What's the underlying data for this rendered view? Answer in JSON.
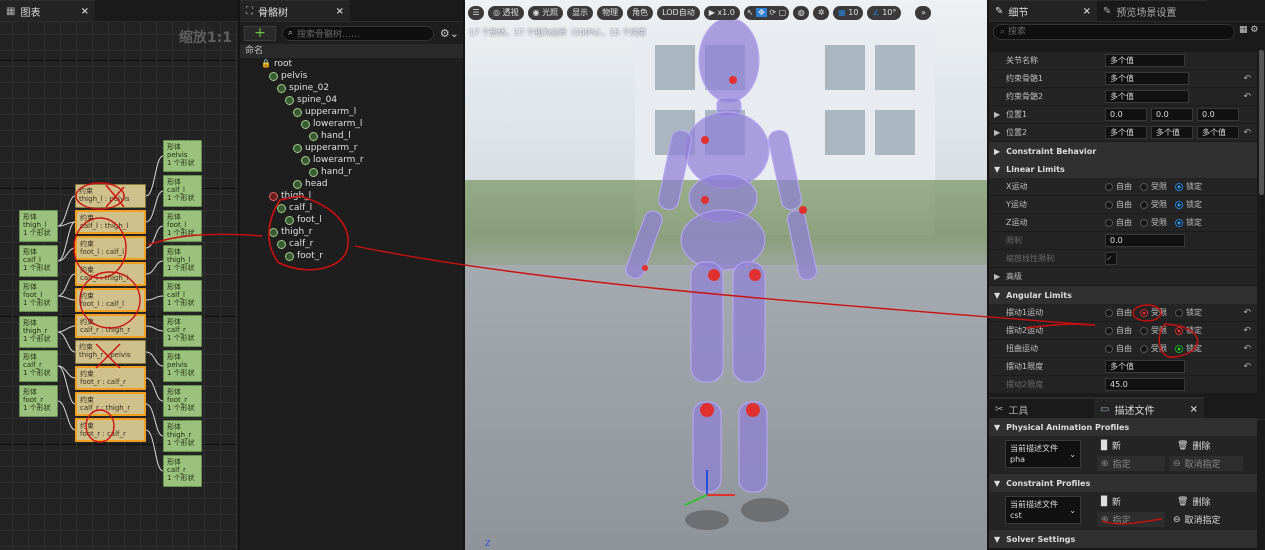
{
  "graph": {
    "tab_label": "图表",
    "zoom_label": "缩放1:1",
    "left_bodies": [
      {
        "name": "形体",
        "bone": "thigh_l",
        "count": "1 个形状"
      },
      {
        "name": "形体",
        "bone": "calf_l",
        "count": "1 个形状"
      },
      {
        "name": "形体",
        "bone": "foot_l",
        "count": "1 个形状"
      },
      {
        "name": "形体",
        "bone": "thigh_r",
        "count": "1 个形状"
      },
      {
        "name": "形体",
        "bone": "calf_r",
        "count": "1 个形状"
      },
      {
        "name": "形体",
        "bone": "foot_r",
        "count": "1 个形状"
      }
    ],
    "constraints": [
      {
        "title": "约束",
        "pair": "thigh_l : pelvis"
      },
      {
        "title": "约束",
        "pair": "calf_l : thigh_l"
      },
      {
        "title": "约束",
        "pair": "foot_l : calf_l"
      },
      {
        "title": "约束",
        "pair": "calf_l : thigh_l"
      },
      {
        "title": "约束",
        "pair": "foot_l : calf_l"
      },
      {
        "title": "约束",
        "pair": "calf_r : thigh_r"
      },
      {
        "title": "约束",
        "pair": "thigh_r : pelvis"
      },
      {
        "title": "约束",
        "pair": "foot_r : calf_r"
      },
      {
        "title": "约束",
        "pair": "calf_r : thigh_r"
      },
      {
        "title": "约束",
        "pair": "foot_r : calf_r"
      }
    ],
    "right_bodies": [
      {
        "name": "形体",
        "bone": "pelvis",
        "count": "1 个形状"
      },
      {
        "name": "形体",
        "bone": "calf_l",
        "count": "1 个形状"
      },
      {
        "name": "形体",
        "bone": "foot_l",
        "count": "1 个形状"
      },
      {
        "name": "形体",
        "bone": "thigh_l",
        "count": "1 个形状"
      },
      {
        "name": "形体",
        "bone": "calf_l",
        "count": "1 个形状"
      },
      {
        "name": "形体",
        "bone": "calf_r",
        "count": "1 个形状"
      },
      {
        "name": "形体",
        "bone": "pelvis",
        "count": "1 个形状"
      },
      {
        "name": "形体",
        "bone": "foot_r",
        "count": "1 个形状"
      },
      {
        "name": "形体",
        "bone": "thigh_r",
        "count": "1 个形状"
      },
      {
        "name": "形体",
        "bone": "calf_r",
        "count": "1 个形状"
      }
    ]
  },
  "skeleton": {
    "tab_label": "骨骼树",
    "search_placeholder": "搜索骨骼树……",
    "column_header": "命名",
    "bones": [
      {
        "label": "root",
        "icon": "lock"
      },
      {
        "label": "pelvis",
        "icon": "bone"
      },
      {
        "label": "spine_02",
        "icon": "bone"
      },
      {
        "label": "spine_04",
        "icon": "bone"
      },
      {
        "label": "upperarm_l",
        "icon": "bone"
      },
      {
        "label": "lowerarm_l",
        "icon": "bone"
      },
      {
        "label": "hand_l",
        "icon": "bone"
      },
      {
        "label": "upperarm_r",
        "icon": "bone"
      },
      {
        "label": "lowerarm_r",
        "icon": "bone"
      },
      {
        "label": "hand_r",
        "icon": "bone"
      },
      {
        "label": "head",
        "icon": "bone"
      },
      {
        "label": "thigh_l",
        "icon": "bone-red"
      },
      {
        "label": "calf_l",
        "icon": "bone"
      },
      {
        "label": "foot_l",
        "icon": "bone"
      },
      {
        "label": "thigh_r",
        "icon": "bone"
      },
      {
        "label": "calf_r",
        "icon": "bone"
      },
      {
        "label": "foot_r",
        "icon": "bone"
      }
    ]
  },
  "viewport": {
    "buttons": [
      "透视",
      "光照",
      "显示",
      "物理",
      "角色",
      "LOD自动",
      "x1.0"
    ],
    "grid_value": "10",
    "angle_value": "10°",
    "info": "17 个形体，17 个视为边界（100%），15 个约束",
    "axis_label": "Z"
  },
  "details": {
    "tab_label": "细节",
    "tab2_label": "预览场景设置",
    "search_placeholder": "搜索",
    "rows": {
      "joint_name": {
        "label": "关节名称",
        "value": "多个值"
      },
      "bone1": {
        "label": "约束骨骼1",
        "value": "多个值"
      },
      "bone2": {
        "label": "约束骨骼2",
        "value": "多个值"
      },
      "pos1": {
        "label": "位置1",
        "x": "0.0",
        "y": "0.0",
        "z": "0.0"
      },
      "pos2": {
        "label": "位置2",
        "x": "多个值",
        "y": "多个值",
        "z": "多个值"
      }
    },
    "section_constraint_behavior": "Constraint Behavior",
    "section_linear": "Linear Limits",
    "linear": [
      {
        "label": "X运动",
        "opts": [
          "自由",
          "受限",
          "锁定"
        ],
        "selected": 2
      },
      {
        "label": "Y运动",
        "opts": [
          "自由",
          "受限",
          "锁定"
        ],
        "selected": 2
      },
      {
        "label": "Z运动",
        "opts": [
          "自由",
          "受限",
          "锁定"
        ],
        "selected": 2
      }
    ],
    "limit": {
      "label": "限制",
      "value": "0.0"
    },
    "scale_limit": {
      "label": "缩放线性限制"
    },
    "advanced": "高级",
    "section_angular": "Angular Limits",
    "angular": [
      {
        "label": "摆动1运动",
        "opts": [
          "自由",
          "受限",
          "锁定"
        ],
        "selected": 1
      },
      {
        "label": "摆动2运动",
        "opts": [
          "自由",
          "受限",
          "锁定"
        ],
        "selected": 2
      },
      {
        "label": "扭曲运动",
        "opts": [
          "自由",
          "受限",
          "锁定"
        ],
        "selected": 2
      }
    ],
    "swing1_limit": {
      "label": "摆动1限度",
      "value": "多个值"
    },
    "swing2_limit": {
      "label": "摆动2限度",
      "value": "45.0"
    }
  },
  "tools": {
    "tab_label": "工具",
    "tab2_label": "描述文件",
    "section_phys": "Physical Animation Profiles",
    "section_cons": "Constraint Profiles",
    "section_solver": "Solver Settings",
    "current_label": "当前描述文件",
    "phys_value": "pha",
    "cons_value": "cst",
    "new_label": "新",
    "delete_label": "删除",
    "assign_label": "指定",
    "unassign_label": "取消指定"
  },
  "colors": {
    "accent": "#2a7fd4",
    "annotation": "#cc1010",
    "body_node": "#9bc27c",
    "constraint_node": "#d0c08c"
  }
}
